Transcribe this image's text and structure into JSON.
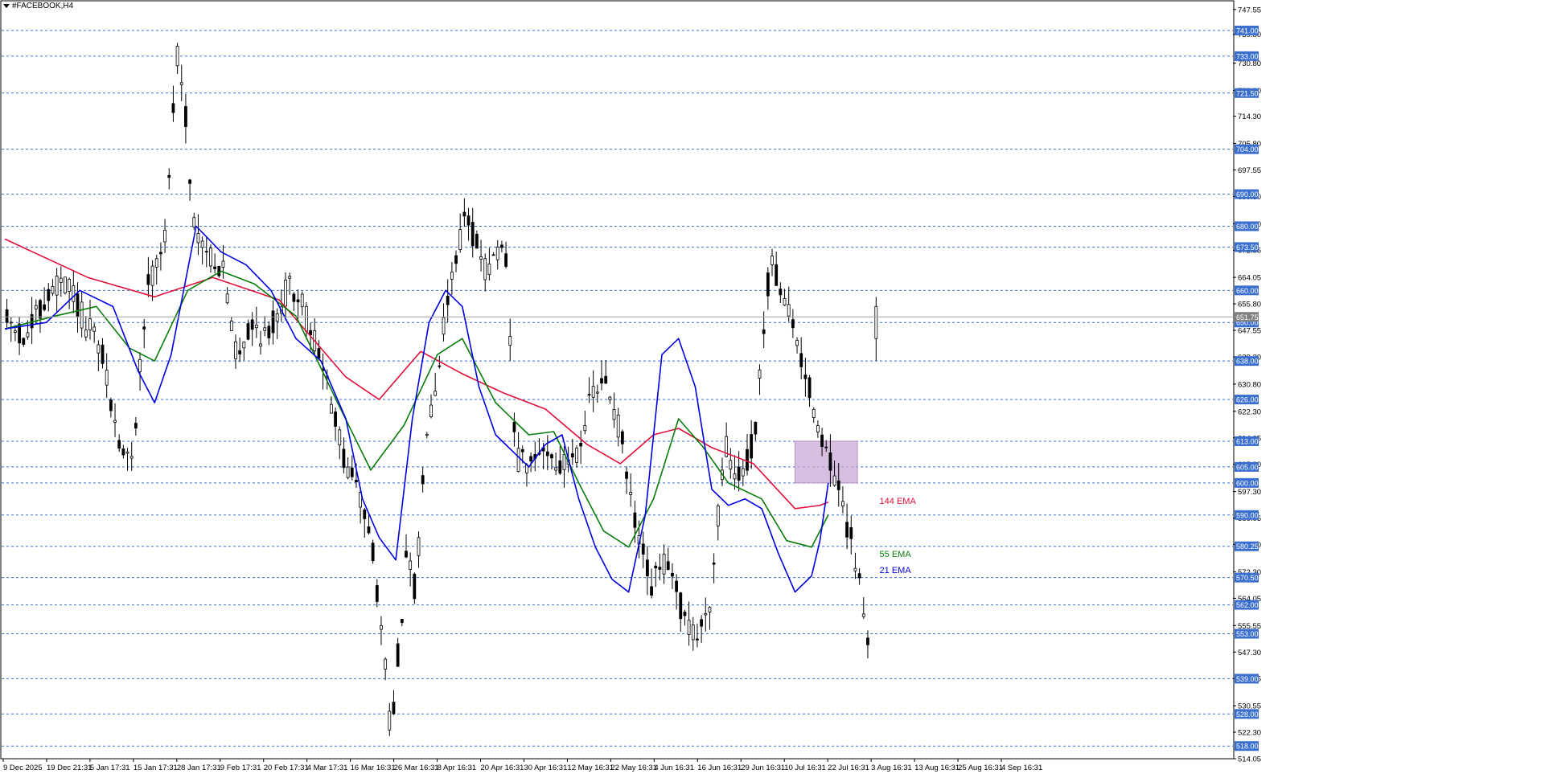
{
  "symbol": {
    "label": "#FACEBOOK,H4",
    "menu_icon": "triangle-down-icon"
  },
  "colors": {
    "background": "#ffffff",
    "grid_level": "#3a6fd0",
    "level_tag_bg": "#3a6fd0",
    "level_tag_text": "#ffffff",
    "candle": "#000000",
    "ema21": "#0000e0",
    "ema55": "#0a7d0a",
    "ema144": "#e0103a",
    "zone_fill": "#c9a9d8",
    "zone_stroke": "#b58fc8"
  },
  "chart_data": {
    "type": "candlestick",
    "title": "#FACEBOOK,H4",
    "ylim": [
      514.05,
      750.0
    ],
    "price_scale_ticks": [
      "747.55",
      "739.80",
      "730.80",
      "722.30",
      "714.30",
      "705.80",
      "697.55",
      "689.30",
      "680.80",
      "672.55",
      "664.05",
      "655.80",
      "647.55",
      "639.30",
      "630.80",
      "622.30",
      "614.05",
      "605.80",
      "597.30",
      "589.05",
      "580.80",
      "572.30",
      "564.05",
      "555.55",
      "547.30",
      "539.05",
      "530.55",
      "522.30",
      "514.05"
    ],
    "horizontal_levels": [
      741.0,
      733.0,
      721.5,
      704.0,
      690.0,
      680.0,
      673.5,
      660.0,
      650.0,
      638.0,
      626.0,
      613.0,
      605.0,
      600.0,
      590.0,
      580.25,
      570.5,
      562.0,
      553.0,
      539.0,
      528.0,
      518.0
    ],
    "level_labels": [
      "741.00",
      "733.00",
      "721.50",
      "704.00",
      "690.00",
      "680.00",
      "673.50",
      "660.00",
      "650.00",
      "638.00",
      "626.00",
      "613.00",
      "605.00",
      "600.00",
      "590.00",
      "580.25",
      "570.50",
      "562.00",
      "553.00",
      "539.00",
      "528.00",
      "518.00"
    ],
    "current_price": "651.75",
    "x_tick_labels": [
      "9 Dec 2025",
      "19 Dec 21:31",
      "5 Jan 17:31",
      "15 Jan 17:31",
      "28 Jan 17:31",
      "9 Feb 17:31",
      "20 Feb 17:31",
      "4 Mar 17:31",
      "16 Mar 16:31",
      "26 Mar 16:31",
      "8 Apr 16:31",
      "20 Apr 16:31",
      "30 Apr 16:31",
      "12 May 16:31",
      "22 May 16:31",
      "4 Jun 16:31",
      "16 Jun 16:31",
      "29 Jun 16:31",
      "10 Jul 16:31",
      "22 Jul 16:31",
      "3 Aug 16:31",
      "13 Aug 16:31",
      "25 Aug 16:31",
      "4 Sep 16:31"
    ],
    "bar_count": 240,
    "anchors": [
      [
        0,
        650
      ],
      [
        8,
        645
      ],
      [
        14,
        655
      ],
      [
        20,
        662
      ],
      [
        26,
        660
      ],
      [
        30,
        652
      ],
      [
        38,
        640
      ],
      [
        44,
        615
      ],
      [
        50,
        605
      ],
      [
        56,
        660
      ],
      [
        60,
        670
      ],
      [
        64,
        678
      ],
      [
        68,
        736
      ],
      [
        72,
        712
      ],
      [
        75,
        680
      ],
      [
        80,
        672
      ],
      [
        86,
        668
      ],
      [
        92,
        640
      ],
      [
        98,
        650
      ],
      [
        104,
        645
      ],
      [
        110,
        656
      ],
      [
        114,
        663
      ],
      [
        118,
        655
      ],
      [
        122,
        648
      ],
      [
        128,
        632
      ],
      [
        134,
        610
      ],
      [
        140,
        598
      ],
      [
        146,
        585
      ],
      [
        150,
        555
      ],
      [
        154,
        522
      ],
      [
        160,
        575
      ],
      [
        164,
        566
      ],
      [
        168,
        618
      ],
      [
        172,
        632
      ],
      [
        176,
        655
      ],
      [
        180,
        672
      ],
      [
        184,
        683
      ],
      [
        188,
        676
      ],
      [
        192,
        666
      ],
      [
        196,
        672
      ],
      [
        200,
        668
      ],
      [
        204,
        607
      ],
      [
        210,
        605
      ],
      [
        216,
        612
      ],
      [
        222,
        604
      ],
      [
        228,
        610
      ],
      [
        234,
        625
      ],
      [
        240,
        632
      ],
      [
        246,
        615
      ],
      [
        252,
        585
      ],
      [
        258,
        568
      ],
      [
        264,
        575
      ],
      [
        270,
        562
      ],
      [
        276,
        550
      ],
      [
        282,
        565
      ],
      [
        288,
        612
      ],
      [
        294,
        600
      ],
      [
        300,
        616
      ],
      [
        306,
        670
      ],
      [
        310,
        662
      ],
      [
        314,
        650
      ],
      [
        318,
        640
      ],
      [
        322,
        628
      ],
      [
        326,
        616
      ],
      [
        332,
        600
      ],
      [
        338,
        583
      ],
      [
        342,
        566
      ],
      [
        346,
        550
      ],
      [
        350,
        536
      ],
      [
        356,
        565
      ],
      [
        362,
        580
      ],
      [
        366,
        588
      ],
      [
        370,
        576
      ],
      [
        374,
        572
      ],
      [
        378,
        562
      ],
      [
        382,
        556
      ],
      [
        386,
        548
      ],
      [
        390,
        565
      ],
      [
        393,
        592
      ],
      [
        396,
        608
      ],
      [
        400,
        611
      ]
    ],
    "ema21": [
      [
        0,
        648
      ],
      [
        10,
        650
      ],
      [
        18,
        660
      ],
      [
        26,
        655
      ],
      [
        32,
        635
      ],
      [
        36,
        625
      ],
      [
        40,
        640
      ],
      [
        46,
        680
      ],
      [
        52,
        672
      ],
      [
        58,
        668
      ],
      [
        64,
        660
      ],
      [
        70,
        645
      ],
      [
        76,
        638
      ],
      [
        82,
        620
      ],
      [
        86,
        595
      ],
      [
        90,
        583
      ],
      [
        94,
        576
      ],
      [
        98,
        620
      ],
      [
        102,
        650
      ],
      [
        106,
        660
      ],
      [
        110,
        655
      ],
      [
        114,
        630
      ],
      [
        118,
        615
      ],
      [
        122,
        610
      ],
      [
        126,
        605
      ],
      [
        130,
        612
      ],
      [
        134,
        615
      ],
      [
        138,
        595
      ],
      [
        142,
        580
      ],
      [
        146,
        570
      ],
      [
        150,
        566
      ],
      [
        154,
        590
      ],
      [
        158,
        640
      ],
      [
        162,
        645
      ],
      [
        166,
        630
      ],
      [
        170,
        598
      ],
      [
        174,
        593
      ],
      [
        178,
        595
      ],
      [
        182,
        592
      ],
      [
        186,
        578
      ],
      [
        190,
        566
      ],
      [
        194,
        571
      ],
      [
        196,
        582
      ],
      [
        198,
        600
      ]
    ],
    "ema55": [
      [
        0,
        648
      ],
      [
        12,
        652
      ],
      [
        22,
        655
      ],
      [
        30,
        642
      ],
      [
        36,
        638
      ],
      [
        44,
        660
      ],
      [
        52,
        666
      ],
      [
        60,
        662
      ],
      [
        70,
        652
      ],
      [
        80,
        625
      ],
      [
        88,
        604
      ],
      [
        96,
        618
      ],
      [
        104,
        640
      ],
      [
        110,
        645
      ],
      [
        118,
        625
      ],
      [
        126,
        615
      ],
      [
        132,
        616
      ],
      [
        138,
        600
      ],
      [
        144,
        585
      ],
      [
        150,
        580
      ],
      [
        156,
        595
      ],
      [
        162,
        620
      ],
      [
        168,
        611
      ],
      [
        174,
        600
      ],
      [
        182,
        595
      ],
      [
        188,
        582
      ],
      [
        194,
        580
      ],
      [
        198,
        590
      ]
    ],
    "ema144": [
      [
        0,
        676
      ],
      [
        20,
        664
      ],
      [
        36,
        658
      ],
      [
        50,
        664
      ],
      [
        66,
        657
      ],
      [
        82,
        633
      ],
      [
        90,
        626
      ],
      [
        100,
        641
      ],
      [
        110,
        634
      ],
      [
        120,
        628
      ],
      [
        130,
        623
      ],
      [
        140,
        612
      ],
      [
        148,
        606
      ],
      [
        156,
        615
      ],
      [
        162,
        617
      ],
      [
        170,
        611
      ],
      [
        180,
        606
      ],
      [
        190,
        592
      ],
      [
        196,
        593
      ],
      [
        198,
        594
      ]
    ],
    "zone": {
      "x_from_bar": 190,
      "x_to_bar": 205,
      "y_low": 600.0,
      "y_high": 613.0
    },
    "annotations": [
      {
        "label": "144 EMA",
        "color": "#e0103a",
        "price": 594.0
      },
      {
        "label": "55 EMA",
        "color": "#0a7d0a",
        "price": 577.5
      },
      {
        "label": "21 EMA",
        "color": "#0000e0",
        "price": 572.5
      }
    ]
  }
}
